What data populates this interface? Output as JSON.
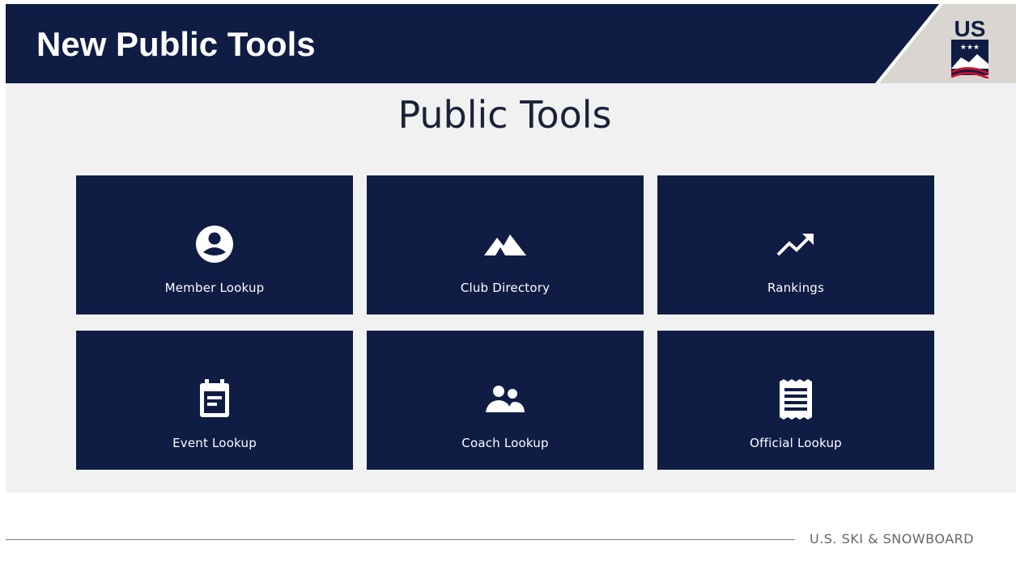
{
  "header": {
    "title": "New Public Tools",
    "logo_text": "US"
  },
  "main": {
    "heading": "Public Tools",
    "tiles": [
      {
        "label": "Member Lookup",
        "icon": "person-circle-icon"
      },
      {
        "label": "Club Directory",
        "icon": "mountain-icon"
      },
      {
        "label": "Rankings",
        "icon": "trending-up-icon"
      },
      {
        "label": "Event Lookup",
        "icon": "calendar-icon"
      },
      {
        "label": "Coach Lookup",
        "icon": "people-icon"
      },
      {
        "label": "Official Lookup",
        "icon": "receipt-icon"
      }
    ]
  },
  "footer": {
    "brand": "U.S. SKI & SNOWBOARD"
  },
  "colors": {
    "navy": "#0f1c44",
    "panel_background": "#f1f1f1",
    "flag_red": "#c8102e"
  }
}
